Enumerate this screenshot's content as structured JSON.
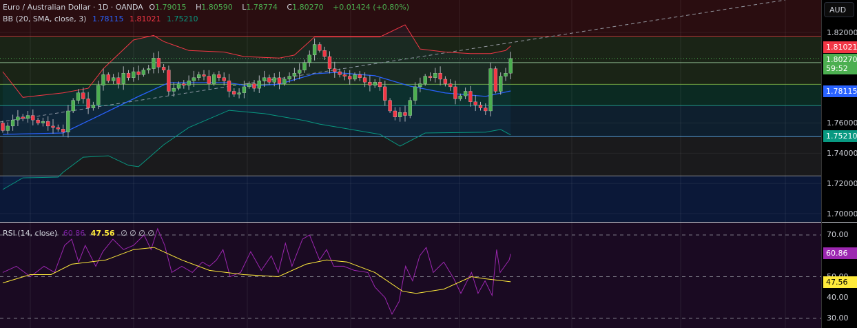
{
  "header": {
    "symbol": "Euro / Australian Dollar · 1D · OANDA",
    "open_label": "O",
    "open": "1.79015",
    "high_label": "H",
    "high": "1.80590",
    "low_label": "L",
    "low": "1.78774",
    "close_label": "C",
    "close": "1.80270",
    "change": "+0.01424 (+0.80%)"
  },
  "bb_legend": {
    "title": "BB (20, SMA, close, 3)",
    "basis": "1.78115",
    "upper": "1.81021",
    "lower": "1.75210"
  },
  "rsi_legend": {
    "title": "RSI (14, close)",
    "rsi": "60.86",
    "ma": "47.56",
    "extra": "∅ ∅ ∅ ∅"
  },
  "price_axis": {
    "currency": "AUD",
    "ticks": [
      "1.82000",
      "1.76000",
      "1.74000",
      "1.72000",
      "1.70000"
    ],
    "tags": {
      "upper": "1.81021",
      "last": "1.80270",
      "countdown": "59:52",
      "basis": "1.78115",
      "lower": "1.75210"
    }
  },
  "rsi_axis": {
    "ticks": [
      "70.00",
      "40.00",
      "30.00"
    ],
    "fifty": "50.00",
    "tags": {
      "rsi": "60.86",
      "ma": "47.56"
    }
  },
  "colors": {
    "up": "#4caf50",
    "down": "#f23645",
    "basis": "#2962ff",
    "upper": "#f23645",
    "lower": "#089981",
    "rsi": "#9c27b0",
    "rsi_ma": "#ffeb3b"
  },
  "chart_data": [
    {
      "type": "candlestick",
      "title": "Euro / Australian Dollar · 1D · OANDA",
      "ylim": [
        1.695,
        1.842
      ],
      "closes": [
        1.755,
        1.758,
        1.762,
        1.764,
        1.763,
        1.765,
        1.762,
        1.76,
        1.761,
        1.758,
        1.757,
        1.756,
        1.754,
        1.768,
        1.775,
        1.78,
        1.776,
        1.77,
        1.772,
        1.785,
        1.792,
        1.788,
        1.79,
        1.786,
        1.793,
        1.79,
        1.794,
        1.792,
        1.795,
        1.796,
        1.803,
        1.797,
        1.795,
        1.781,
        1.783,
        1.786,
        1.785,
        1.788,
        1.79,
        1.792,
        1.791,
        1.786,
        1.792,
        1.79,
        1.788,
        1.781,
        1.779,
        1.78,
        1.784,
        1.786,
        1.783,
        1.788,
        1.79,
        1.787,
        1.79,
        1.786,
        1.789,
        1.791,
        1.793,
        1.795,
        1.8,
        1.805,
        1.812,
        1.808,
        1.804,
        1.796,
        1.794,
        1.792,
        1.791,
        1.789,
        1.792,
        1.79,
        1.787,
        1.785,
        1.787,
        1.784,
        1.775,
        1.768,
        1.764,
        1.767,
        1.765,
        1.775,
        1.784,
        1.786,
        1.791,
        1.79,
        1.793,
        1.789,
        1.786,
        1.784,
        1.776,
        1.778,
        1.781,
        1.774,
        1.772,
        1.77,
        1.768,
        1.796,
        1.781,
        1.791,
        1.793,
        1.8027
      ],
      "first_open": 1.76,
      "bb_upper": [
        [
          0,
          1.794
        ],
        [
          4,
          1.777
        ],
        [
          12,
          1.78
        ],
        [
          17,
          1.783
        ],
        [
          20,
          1.796
        ],
        [
          26,
          1.815
        ],
        [
          30,
          1.818
        ],
        [
          32,
          1.814
        ],
        [
          37,
          1.808
        ],
        [
          44,
          1.807
        ],
        [
          48,
          1.804
        ],
        [
          55,
          1.803
        ],
        [
          58,
          1.805
        ],
        [
          62,
          1.817
        ],
        [
          65,
          1.817
        ],
        [
          70,
          1.817
        ],
        [
          75,
          1.817
        ],
        [
          80,
          1.825
        ],
        [
          83,
          1.809
        ],
        [
          88,
          1.807
        ],
        [
          93,
          1.806
        ],
        [
          97,
          1.806
        ],
        [
          100,
          1.808
        ],
        [
          101,
          1.811
        ]
      ],
      "bb_basis": [
        [
          0,
          1.7525
        ],
        [
          12,
          1.7534
        ],
        [
          18,
          1.763
        ],
        [
          27,
          1.7776
        ],
        [
          33,
          1.7867
        ],
        [
          45,
          1.7867
        ],
        [
          49,
          1.7844
        ],
        [
          55,
          1.7858
        ],
        [
          62,
          1.7926
        ],
        [
          66,
          1.7935
        ],
        [
          74,
          1.7913
        ],
        [
          81,
          1.7844
        ],
        [
          88,
          1.7799
        ],
        [
          96,
          1.7776
        ],
        [
          101,
          1.7812
        ]
      ],
      "bb_lower": [
        [
          0,
          1.716
        ],
        [
          4,
          1.7237
        ],
        [
          11,
          1.7242
        ],
        [
          12,
          1.7274
        ],
        [
          16,
          1.7374
        ],
        [
          21,
          1.7383
        ],
        [
          25,
          1.732
        ],
        [
          27,
          1.7311
        ],
        [
          32,
          1.7456
        ],
        [
          37,
          1.757
        ],
        [
          45,
          1.7684
        ],
        [
          52,
          1.7662
        ],
        [
          60,
          1.7616
        ],
        [
          63,
          1.7593
        ],
        [
          75,
          1.7525
        ],
        [
          79,
          1.7447
        ],
        [
          84,
          1.7534
        ],
        [
          96,
          1.7539
        ],
        [
          99,
          1.7557
        ],
        [
          101,
          1.7521
        ]
      ],
      "levels": [
        1.8175,
        1.8027,
        1.8,
        1.7856,
        1.7715,
        1.751,
        1.725
      ]
    },
    {
      "type": "line",
      "title": "RSI (14, close)",
      "ylim": [
        24,
        76
      ],
      "bands": [
        70,
        50,
        30
      ],
      "rsi": [
        [
          0,
          52
        ],
        [
          2.7,
          55
        ],
        [
          5.5,
          50
        ],
        [
          8.2,
          55
        ],
        [
          10.3,
          52
        ],
        [
          12.3,
          65
        ],
        [
          13.7,
          68
        ],
        [
          15.1,
          57
        ],
        [
          16.4,
          65
        ],
        [
          18.5,
          55
        ],
        [
          19.9,
          62
        ],
        [
          21.9,
          68
        ],
        [
          24,
          63
        ],
        [
          26,
          65
        ],
        [
          28.1,
          70
        ],
        [
          29.5,
          63
        ],
        [
          30.8,
          73
        ],
        [
          32.2,
          65
        ],
        [
          33.6,
          52
        ],
        [
          35.6,
          55
        ],
        [
          37.7,
          52
        ],
        [
          39.7,
          57
        ],
        [
          41.1,
          55
        ],
        [
          42.5,
          58
        ],
        [
          43.8,
          63
        ],
        [
          45.2,
          50
        ],
        [
          47.3,
          52
        ],
        [
          49.3,
          62
        ],
        [
          51.4,
          53
        ],
        [
          53.4,
          60
        ],
        [
          54.8,
          52
        ],
        [
          56.2,
          66
        ],
        [
          57.5,
          55
        ],
        [
          59.6,
          68
        ],
        [
          61,
          70
        ],
        [
          63,
          58
        ],
        [
          64.4,
          63
        ],
        [
          65.8,
          55
        ],
        [
          67.8,
          55
        ],
        [
          69.9,
          53
        ],
        [
          72.6,
          52
        ],
        [
          74,
          45
        ],
        [
          76,
          40
        ],
        [
          77.4,
          32
        ],
        [
          78.8,
          38
        ],
        [
          80.1,
          55
        ],
        [
          81.5,
          48
        ],
        [
          82.9,
          60
        ],
        [
          84.2,
          64
        ],
        [
          85.6,
          52
        ],
        [
          87.7,
          57
        ],
        [
          89.7,
          49
        ],
        [
          91.1,
          42
        ],
        [
          93.2,
          52
        ],
        [
          94.5,
          42
        ],
        [
          95.9,
          48
        ],
        [
          97.3,
          41
        ],
        [
          98.2,
          63
        ],
        [
          98.9,
          52
        ],
        [
          100.7,
          58
        ],
        [
          101,
          60.86
        ]
      ],
      "rsi_ma": [
        [
          0,
          47
        ],
        [
          5.5,
          51
        ],
        [
          9.6,
          51
        ],
        [
          13.7,
          56
        ],
        [
          20.5,
          58
        ],
        [
          26,
          63
        ],
        [
          30.1,
          64
        ],
        [
          35.6,
          58
        ],
        [
          41.1,
          53
        ],
        [
          47.9,
          51
        ],
        [
          54.8,
          50
        ],
        [
          60.3,
          56
        ],
        [
          64.4,
          58
        ],
        [
          68.5,
          57
        ],
        [
          74,
          52
        ],
        [
          79.5,
          43
        ],
        [
          82.2,
          42
        ],
        [
          87.7,
          44
        ],
        [
          93.2,
          50
        ],
        [
          95.9,
          49
        ],
        [
          101,
          47.56
        ]
      ]
    }
  ]
}
